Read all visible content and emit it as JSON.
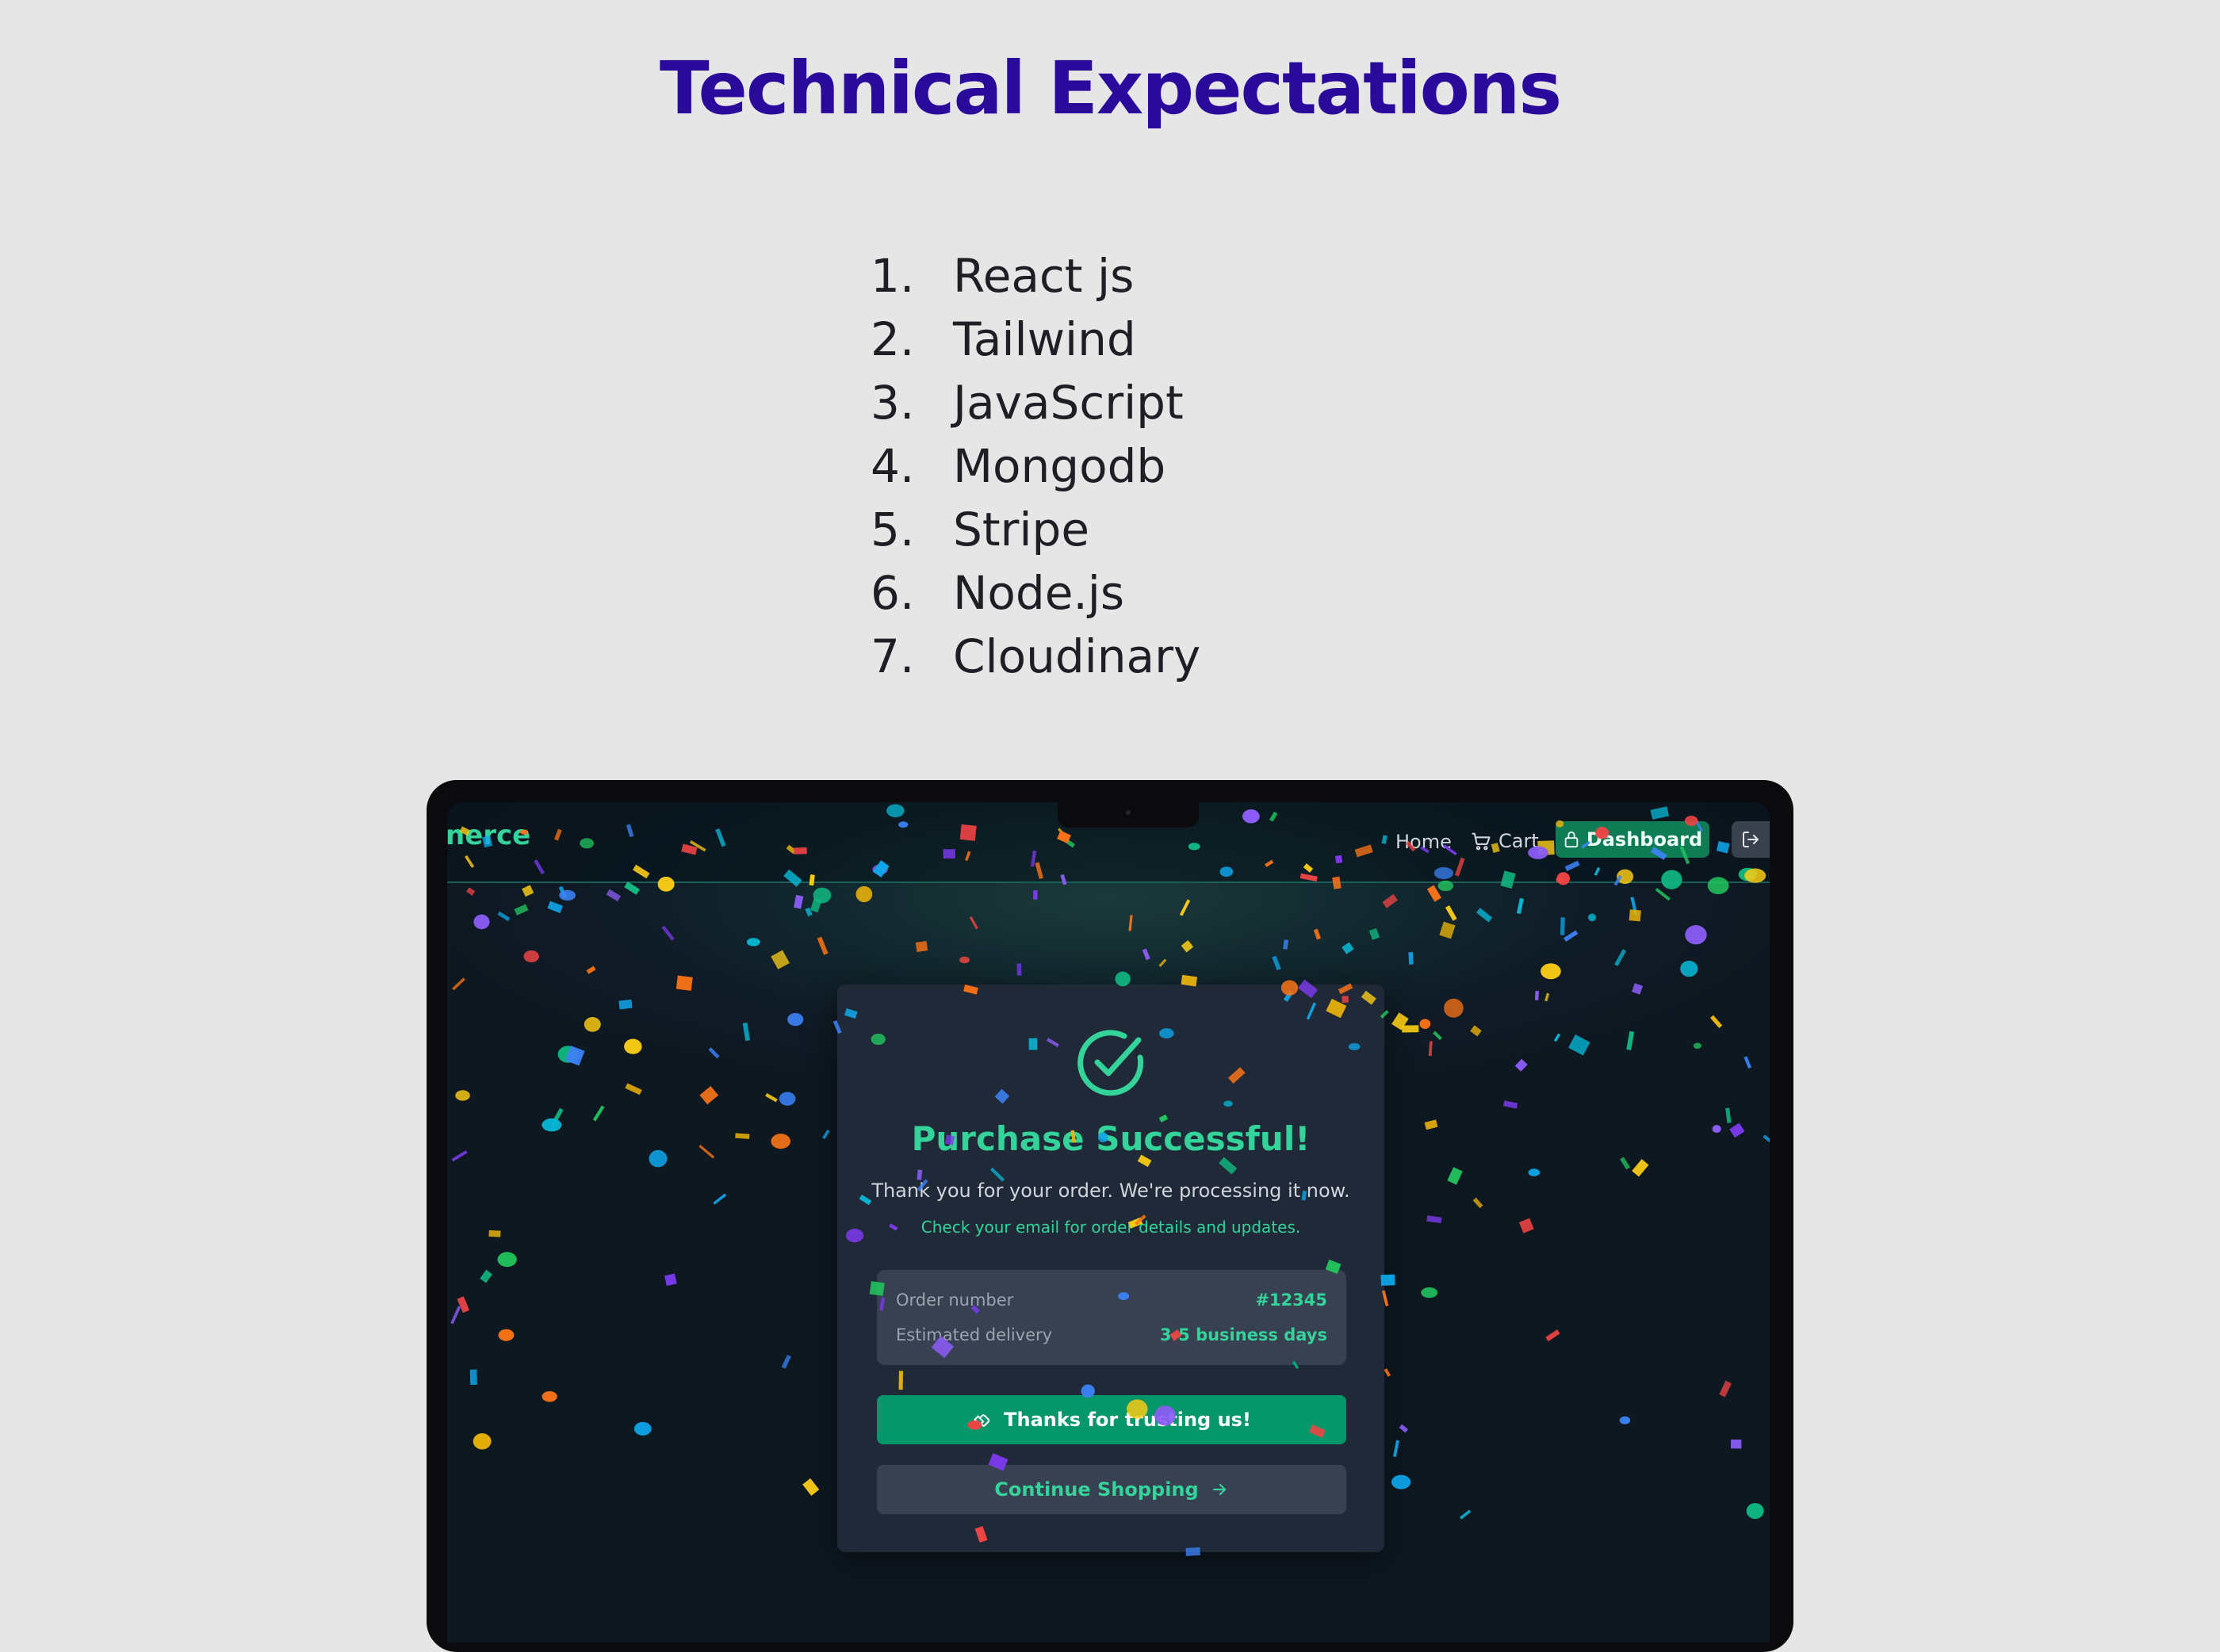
{
  "slide": {
    "title": "Technical Expectations",
    "items": [
      {
        "num": "1.",
        "label": "React js"
      },
      {
        "num": "2.",
        "label": "Tailwind"
      },
      {
        "num": "3.",
        "label": "JavaScript"
      },
      {
        "num": "4.",
        "label": "Mongodb"
      },
      {
        "num": "5.",
        "label": "Stripe"
      },
      {
        "num": "6.",
        "label": "Node.js"
      },
      {
        "num": "7.",
        "label": "Cloudinary"
      }
    ]
  },
  "app": {
    "brand": "nerce",
    "nav": {
      "home": "Home",
      "cart": "Cart",
      "dashboard": "Dashboard",
      "icons": {
        "cart": "cart-icon",
        "dashboard": "lock-icon",
        "logout": "logout-icon"
      }
    },
    "card": {
      "icon": "check-circle-icon",
      "title": "Purchase Successful!",
      "subtitle": "Thank you for your order. We're processing it now.",
      "note": "Check your email for order details and updates.",
      "order_number_label": "Order number",
      "order_number_value": "#12345",
      "delivery_label": "Estimated delivery",
      "delivery_value": "3-5 business days",
      "thanks_button": "Thanks for trusting us!",
      "thanks_icon": "handshake-icon",
      "continue_button": "Continue Shopping",
      "continue_icon": "arrow-right-icon"
    }
  },
  "colors": {
    "title": "#2a0a9b",
    "accent": "#34d399",
    "primary_button": "#059669",
    "card_bg": "#1f2937",
    "screen_bg": "#0e1821"
  }
}
